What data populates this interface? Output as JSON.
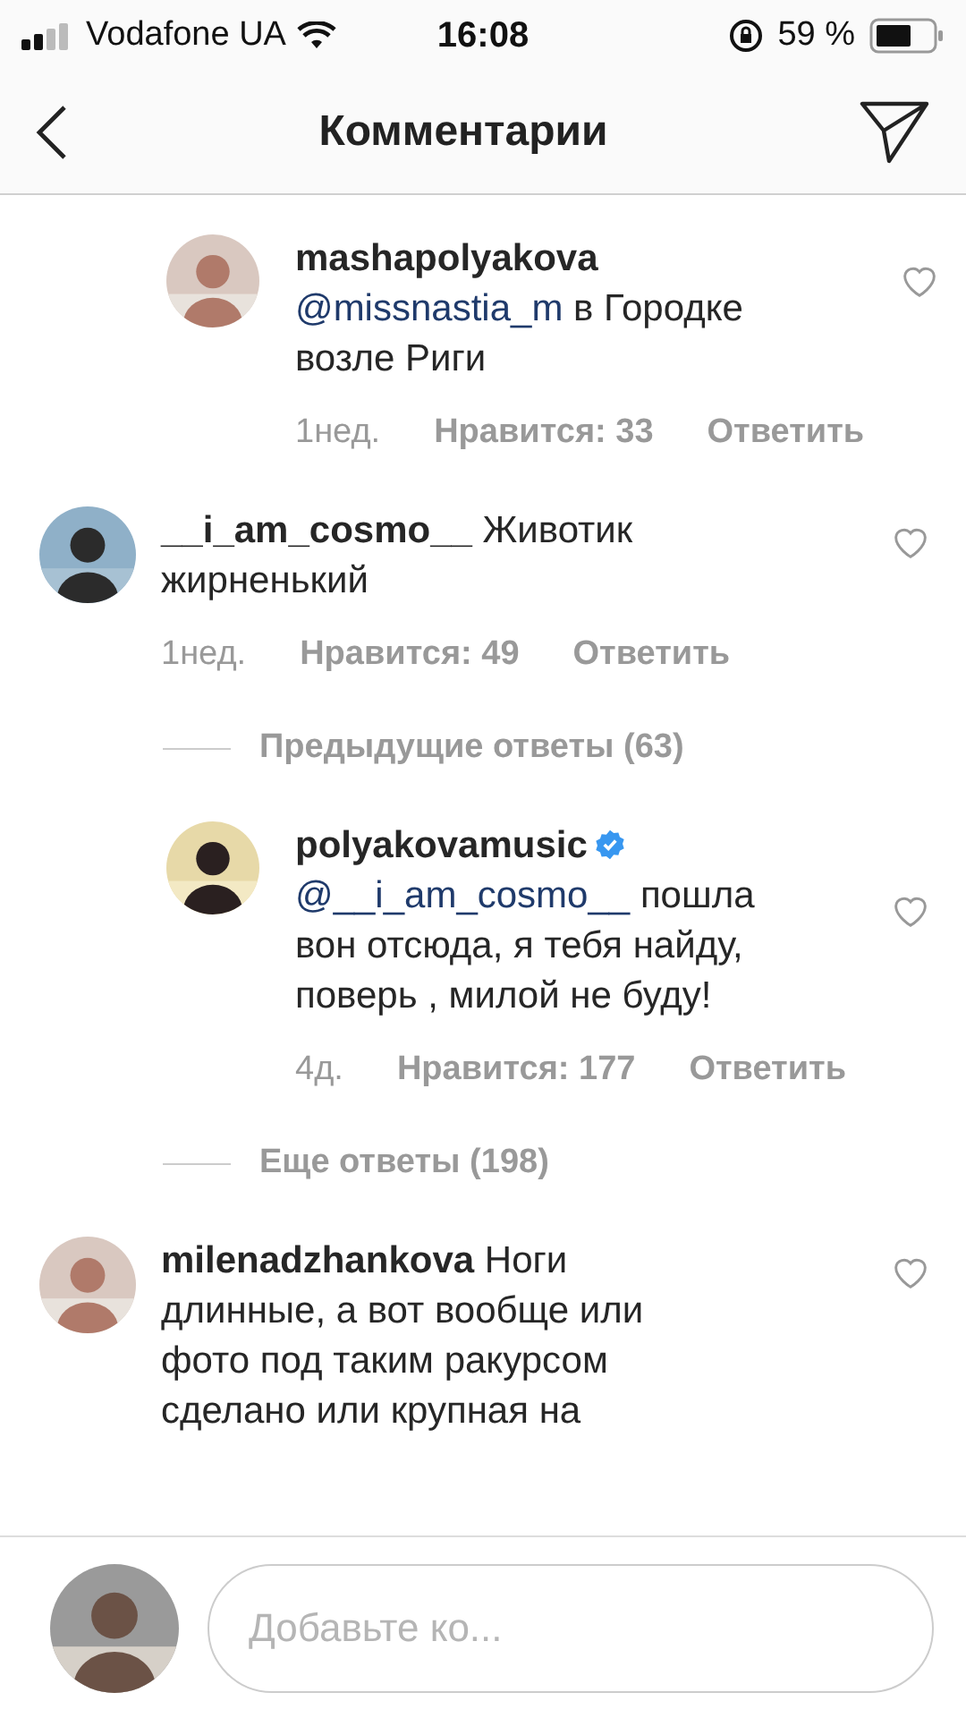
{
  "status_bar": {
    "carrier": "Vodafone UA",
    "time": "16:08",
    "battery": "59 %"
  },
  "header": {
    "title": "Комментарии"
  },
  "thread": [
    {
      "kind": "reply",
      "username": "mashapolyakova",
      "verified": false,
      "mention": "@missnastia_m",
      "text": "в Городке возле Риги",
      "age": "1нед.",
      "likes": "Нравится: 33",
      "reply_label": "Ответить"
    },
    {
      "kind": "comment",
      "username": "__i_am_cosmo__",
      "verified": false,
      "text": "Животик жирненький",
      "age": "1нед.",
      "likes": "Нравится: 49",
      "reply_label": "Ответить"
    },
    {
      "kind": "load_replies",
      "label": "Предыдущие ответы (63)"
    },
    {
      "kind": "reply",
      "username": "polyakovamusic",
      "verified": true,
      "mention": "@__i_am_cosmo__",
      "text": "пошла вон отсюда, я тебя найду, поверь , милой не буду!",
      "age": "4д.",
      "likes": "Нравится: 177",
      "reply_label": "Ответить"
    },
    {
      "kind": "load_replies",
      "label": "Еще ответы (198)"
    },
    {
      "kind": "comment",
      "username": "milenadzhankova",
      "verified": false,
      "text": "Ноги длинные, а вот вообще или фото под таким ракурсом сделано или крупная на"
    }
  ],
  "composer": {
    "placeholder": "Добавьте ко..."
  }
}
